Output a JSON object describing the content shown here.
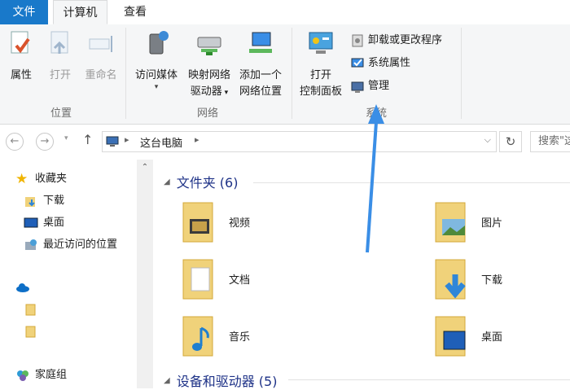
{
  "menubar": {
    "file": "文件",
    "computer": "计算机",
    "view": "查看"
  },
  "ribbon": {
    "location_group": "位置",
    "network_group": "网络",
    "system_group": "系统",
    "properties": "属性",
    "open": "打开",
    "rename": "重命名",
    "access_media": "访问媒体",
    "map_drive_1": "映射网络",
    "map_drive_2": "驱动器",
    "add_location_1": "添加一个",
    "add_location_2": "网络位置",
    "control_panel_1": "打开",
    "control_panel_2": "控制面板",
    "uninstall": "卸载或更改程序",
    "system_properties": "系统属性",
    "manage": "管理"
  },
  "address": {
    "path": "这台电脑",
    "search_placeholder": "搜索\"这"
  },
  "nav": {
    "favorites": "收藏夹",
    "downloads": "下载",
    "desktop": "桌面",
    "recent": "最近访问的位置",
    "homegroup": "家庭组"
  },
  "content": {
    "folders_header": "文件夹 (6)",
    "devices_header": "设备和驱动器 (5)",
    "folders": [
      "视频",
      "图片",
      "文档",
      "下载",
      "音乐",
      "桌面"
    ]
  },
  "colors": {
    "accent": "#1979ca",
    "header_text": "#1e3287",
    "arrow": "#3a8ee6"
  }
}
